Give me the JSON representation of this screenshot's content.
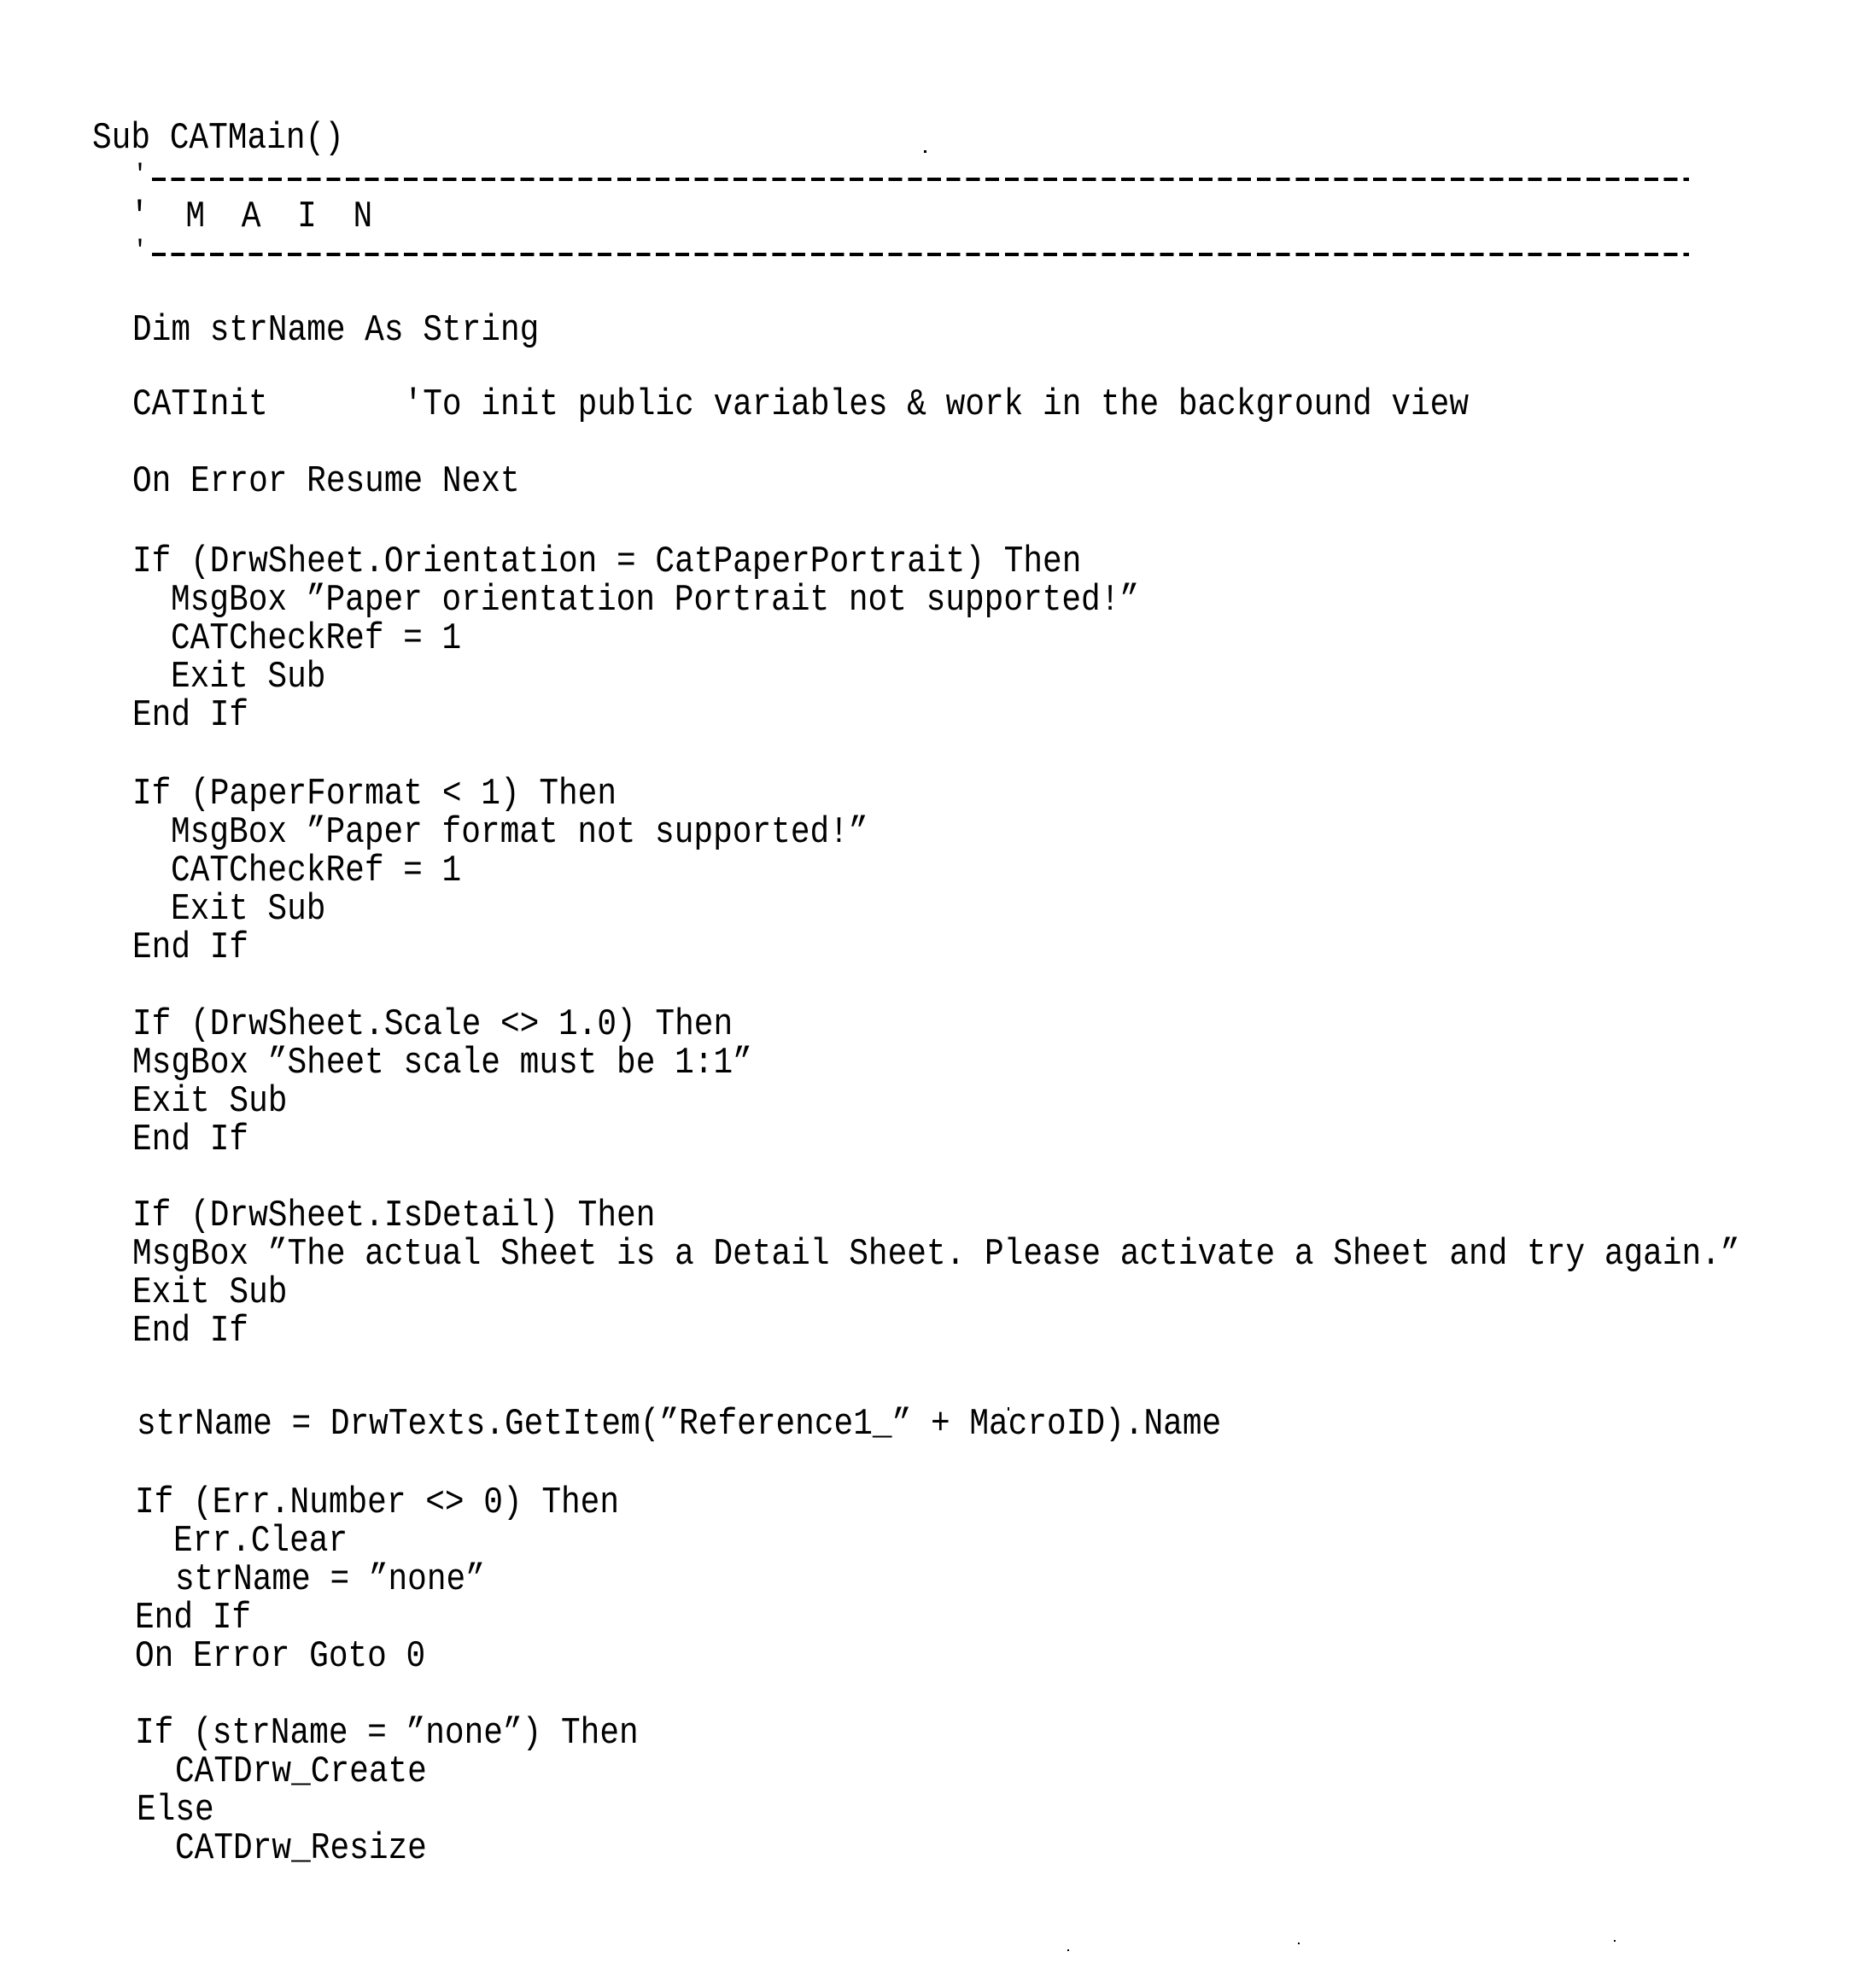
{
  "document": {
    "language": "VBScript",
    "header": {
      "sub_declaration": "Sub CATMain()",
      "banner_rule_prefix": "'",
      "banner_title": "' M A I N",
      "banner_rule_bottom_prefix": "'"
    },
    "lines": [
      {
        "text": "Dim strName As String",
        "indent": 1
      },
      {
        "text": "CATInit       'To init public variables & work in the background view",
        "indent": 1
      },
      {
        "text": "On Error Resume Next",
        "indent": 1
      },
      {
        "text": "If (DrwSheet.Orientation = CatPaperPortrait) Then",
        "indent": 1
      },
      {
        "text": "MsgBox ”Paper orientation Portrait not supported!”",
        "indent": 2
      },
      {
        "text": "CATCheckRef = 1",
        "indent": 2
      },
      {
        "text": "Exit Sub",
        "indent": 2
      },
      {
        "text": "End If",
        "indent": 1
      },
      {
        "text": "If (PaperFormat < 1) Then",
        "indent": 1
      },
      {
        "text": "MsgBox ”Paper format not supported!”",
        "indent": 2
      },
      {
        "text": "CATCheckRef = 1",
        "indent": 2
      },
      {
        "text": "Exit Sub",
        "indent": 2
      },
      {
        "text": "End If",
        "indent": 1
      },
      {
        "text": "If (DrwSheet.Scale <> 1.0) Then",
        "indent": 1
      },
      {
        "text": "MsgBox ”Sheet scale must be 1:1”",
        "indent": 1
      },
      {
        "text": "Exit Sub",
        "indent": 1
      },
      {
        "text": "End If",
        "indent": 1
      },
      {
        "text": "If (DrwSheet.IsDetail) Then",
        "indent": 1
      },
      {
        "text": "MsgBox ”The actual Sheet is a Detail Sheet. Please activate a Sheet and try again.”",
        "indent": 1
      },
      {
        "text": "Exit Sub",
        "indent": 1
      },
      {
        "text": "End If",
        "indent": 1
      },
      {
        "text": "strName = DrwTexts.GetItem(”Reference1_” + MacroID).Name",
        "indent": 1
      },
      {
        "text": "If (Err.Number <> 0) Then",
        "indent": 1
      },
      {
        "text": "Err.Clear",
        "indent": 2
      },
      {
        "text": "strName = ”none”",
        "indent": 2
      },
      {
        "text": "End If",
        "indent": 1
      },
      {
        "text": "On Error Goto 0",
        "indent": 1
      },
      {
        "text": "If (strName = ”none”) Then",
        "indent": 1
      },
      {
        "text": "CATDrw_Create",
        "indent": 2
      },
      {
        "text": "Else",
        "indent": 1
      },
      {
        "text": "CATDrw_Resize",
        "indent": 2
      }
    ]
  }
}
